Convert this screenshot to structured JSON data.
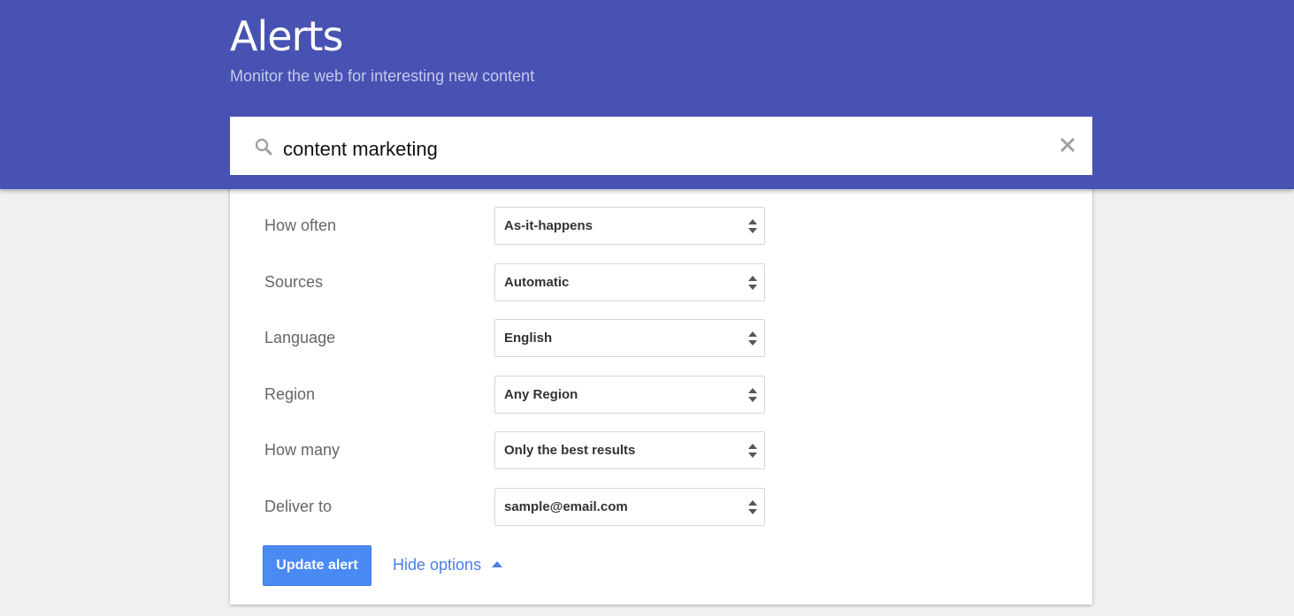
{
  "header": {
    "title": "Alerts",
    "subtitle": "Monitor the web for interesting new content"
  },
  "search": {
    "value": "content marketing",
    "icon": "search-icon",
    "clear_icon": "close-icon"
  },
  "options": [
    {
      "label": "How often",
      "value": "As-it-happens"
    },
    {
      "label": "Sources",
      "value": "Automatic"
    },
    {
      "label": "Language",
      "value": "English"
    },
    {
      "label": "Region",
      "value": "Any Region"
    },
    {
      "label": "How many",
      "value": "Only the best results"
    },
    {
      "label": "Deliver to",
      "value": "sample@email.com"
    }
  ],
  "actions": {
    "update_label": "Update alert",
    "hide_options_label": "Hide options"
  },
  "colors": {
    "header": "#4752b2",
    "primary_button": "#4a8af4",
    "link": "#4a7fe8"
  }
}
